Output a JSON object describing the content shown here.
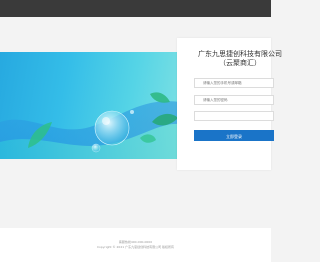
{
  "header": {
    "background_color": "#3a3a3a"
  },
  "banner": {
    "colors": [
      "#27a9e0",
      "#7fe1e3"
    ]
  },
  "login": {
    "company_line1": "广东九思捷创科技有限公司",
    "company_line2": "（云聚商汇）",
    "username_placeholder": "请输入您的手机号或邮箱",
    "password_placeholder": "请输入您的密码",
    "code_placeholder": "",
    "login_button_label": "立即登录",
    "button_color": "#1a74c8"
  },
  "footer": {
    "line1": "客服热线400-000-0000",
    "line2": "Copyright © 2021 广东九思捷创科技有限公司 版权所有"
  }
}
